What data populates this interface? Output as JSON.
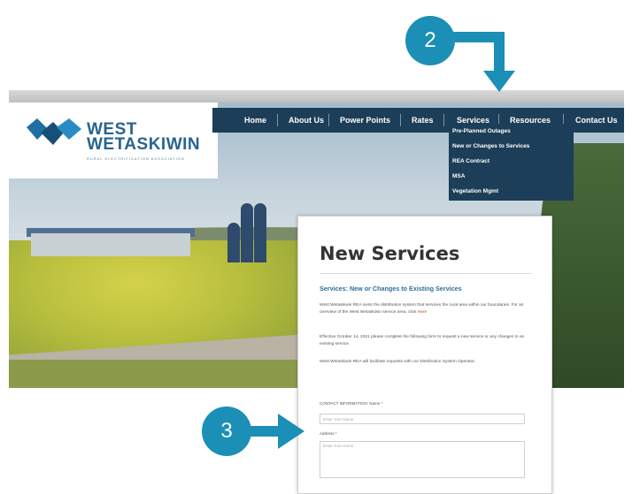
{
  "site": {
    "logo": {
      "line1": "WEST",
      "line2": "WETASKIWIN",
      "tagline": "RURAL ELECTRIFICATION ASSOCIATION"
    },
    "nav": [
      {
        "label": "Home"
      },
      {
        "label": "About Us"
      },
      {
        "label": "Power Points"
      },
      {
        "label": "Rates"
      },
      {
        "label": "Services"
      },
      {
        "label": "Resources"
      },
      {
        "label": "Contact Us"
      }
    ],
    "services_menu": [
      {
        "label": "Pre-Planned Outages"
      },
      {
        "label": "New or Changes to Services"
      },
      {
        "label": "REA Contract"
      },
      {
        "label": "MSA"
      },
      {
        "label": "Vegetation Mgmt"
      }
    ]
  },
  "content": {
    "title": "New Services",
    "subtitle": "Services:  New or Changes to Existing Services",
    "p1": "West Wetaskiwin REA owns the distribution system that services the rural area within our boundaries. For an overview of the West Wetaskiwin service area, click",
    "p1_link": "Here",
    "p2": "Effective October 14, 2021 please complete the following form to request a new service or any changes to an existing service.",
    "p3": "West Wetaskiwin REA will facilitate requests with our Distribution System Operator.",
    "form": {
      "name_label": "CONTACT INFORMATION: Name",
      "name_placeholder": "Enter Your Name",
      "address_label": "Address",
      "address_placeholder": "Enter Your Home",
      "required_mark": "*"
    }
  },
  "callouts": {
    "step2": "2",
    "step3": "3"
  },
  "colors": {
    "callout": "#1b8fb6",
    "nav": "#1c3e58",
    "logo": "#28648e",
    "link": "#c0392b"
  }
}
